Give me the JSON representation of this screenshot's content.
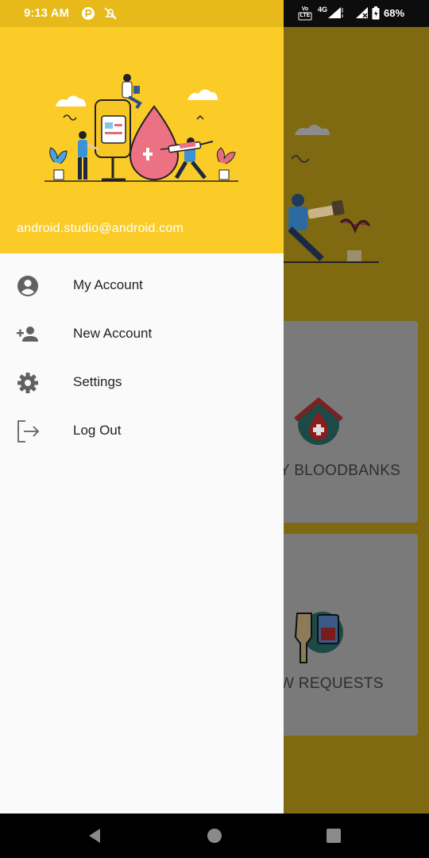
{
  "status_bar": {
    "time": "9:13 AM",
    "battery": "68%",
    "icons": [
      "parking-icon",
      "notifications-off-icon",
      "volte-icon",
      "4g-signal-icon",
      "signal-icon",
      "battery-icon"
    ],
    "volte_text": "Vo LTE",
    "network_text": "4G"
  },
  "drawer": {
    "header": {
      "email": "android.studio@android.com",
      "background_color": "#fbcb28"
    },
    "menu": [
      {
        "label": "My Account",
        "icon": "account-circle-icon"
      },
      {
        "label": "New Account",
        "icon": "person-add-icon"
      },
      {
        "label": "Settings",
        "icon": "gear-icon"
      },
      {
        "label": "Log Out",
        "icon": "logout-icon"
      }
    ]
  },
  "background_app": {
    "cards": [
      {
        "label": "Y BLOODBANKS",
        "icon": "bloodbank-icon"
      },
      {
        "label": "W REQUESTS",
        "icon": "blood-request-icon"
      }
    ]
  },
  "nav_bar": {
    "buttons": [
      "back-icon",
      "home-icon",
      "recents-icon"
    ]
  }
}
